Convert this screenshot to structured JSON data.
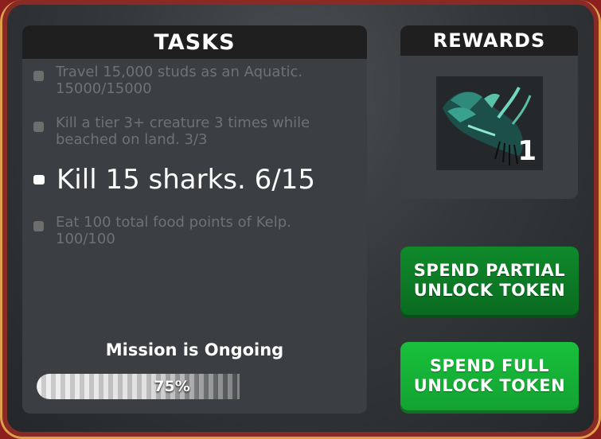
{
  "tasks_panel": {
    "title": "TASKS",
    "tasks": [
      {
        "text": "Travel 15,000 studs as an Aquatic. 15000/15000",
        "status": "complete"
      },
      {
        "text": "Kill a tier 3+ creature 3 times while beached on land. 3/3",
        "status": "complete"
      },
      {
        "text": "Kill 15 sharks. 6/15",
        "status": "active"
      },
      {
        "text": "Eat 100 total food points of Kelp. 100/100",
        "status": "complete"
      }
    ],
    "mission_status": "Mission is Ongoing",
    "progress": {
      "label": "75%",
      "value": 0.75
    }
  },
  "rewards_panel": {
    "title": "REWARDS",
    "reward": {
      "icon": "aquatic-creature-icon",
      "count": "1"
    }
  },
  "buttons": {
    "partial": "SPEND PARTIAL UNLOCK TOKEN",
    "full": "SPEND FULL UNLOCK TOKEN"
  },
  "colors": {
    "frame_border": "#e0a04a",
    "button_partial": "#0f8a2b",
    "button_full": "#19c03c"
  }
}
